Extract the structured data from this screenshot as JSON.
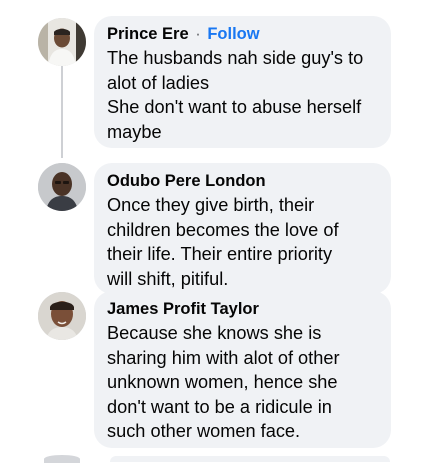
{
  "comments": [
    {
      "author": "Prince Ere",
      "separator": "·",
      "follow_label": "Follow",
      "avatar_icon": "person-avatar-icon",
      "lines": [
        "The husbands nah side guy's to",
        "alot of ladies",
        "She don't want to abuse herself",
        "maybe"
      ]
    },
    {
      "author": "Odubo Pere London",
      "avatar_icon": "person-avatar-icon",
      "lines": [
        "Once they give birth, their",
        "children becomes the love of",
        "their life. Their entire priority",
        "will shift, pitiful."
      ]
    },
    {
      "author": "James Profit Taylor",
      "avatar_icon": "person-avatar-icon",
      "lines": [
        "Because she knows she is",
        "sharing him with alot of other",
        "unknown women, hence she",
        "don't want to be a ridicule in",
        "such other women face."
      ]
    }
  ],
  "colors": {
    "bubble": "#f0f2f5",
    "follow": "#1877f2",
    "text": "#050505",
    "secondary": "#65676b"
  }
}
